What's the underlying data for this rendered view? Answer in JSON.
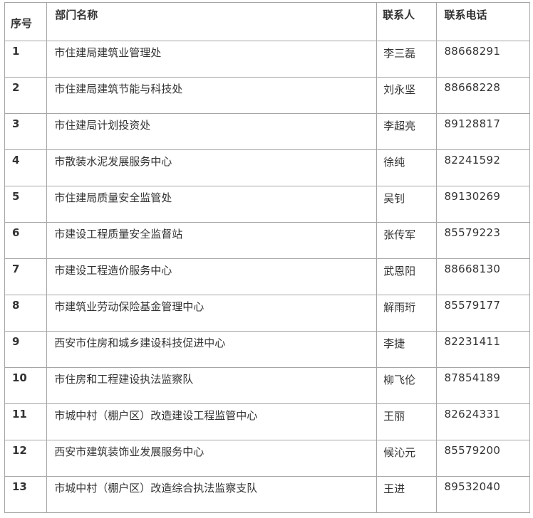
{
  "headers": {
    "seq": "序号",
    "name": "部门名称",
    "contact": "联系人",
    "phone": "联系电话"
  },
  "rows": [
    {
      "seq": "1",
      "name": "市住建局建筑业管理处",
      "contact": "李三磊",
      "phone": "88668291"
    },
    {
      "seq": "2",
      "name": "市住建局建筑节能与科技处",
      "contact": "刘永坚",
      "phone": "88668228"
    },
    {
      "seq": "3",
      "name": "市住建局计划投资处",
      "contact": "李超亮",
      "phone": "89128817"
    },
    {
      "seq": "4",
      "name": "市散装水泥发展服务中心",
      "contact": "徐纯",
      "phone": "82241592"
    },
    {
      "seq": "5",
      "name": "市住建局质量安全监管处",
      "contact": "吴钊",
      "phone": "89130269"
    },
    {
      "seq": "6",
      "name": "市建设工程质量安全监督站",
      "contact": "张传军",
      "phone": "85579223"
    },
    {
      "seq": "7",
      "name": "市建设工程造价服务中心",
      "contact": "武恩阳",
      "phone": "88668130"
    },
    {
      "seq": "8",
      "name": "市建筑业劳动保险基金管理中心",
      "contact": "解雨珩",
      "phone": "85579177"
    },
    {
      "seq": "9",
      "name": "西安市住房和城乡建设科技促进中心",
      "contact": "李捷",
      "phone": "82231411"
    },
    {
      "seq": "10",
      "name": "市住房和工程建设执法监察队",
      "contact": "柳飞伦",
      "phone": "87854189"
    },
    {
      "seq": "11",
      "name": "市城中村（棚户区）改造建设工程监管中心",
      "contact": "王丽",
      "phone": "82624331"
    },
    {
      "seq": "12",
      "name": "西安市建筑装饰业发展服务中心",
      "contact": "候沁元",
      "phone": "85579200"
    },
    {
      "seq": "13",
      "name": "市城中村（棚户区）改造综合执法监察支队",
      "contact": "王进",
      "phone": "89532040"
    }
  ]
}
